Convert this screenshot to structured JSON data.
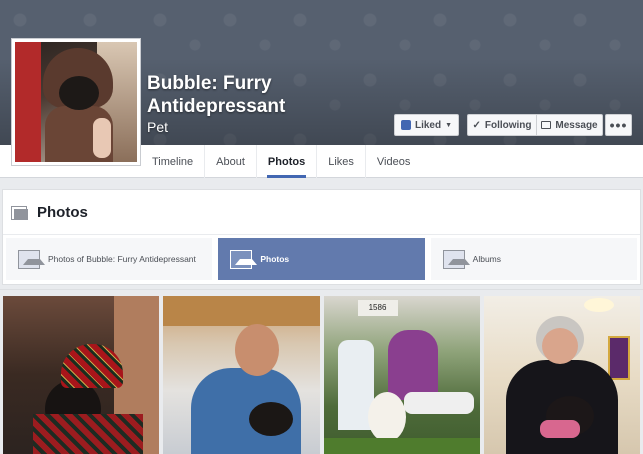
{
  "page": {
    "name": "Bubble: Furry Antidepressant",
    "category": "Pet"
  },
  "actions": {
    "liked_label": "Liked",
    "following_label": "Following",
    "message_label": "Message",
    "more_label": "•••"
  },
  "tabs": [
    {
      "label": "Timeline",
      "active": false
    },
    {
      "label": "About",
      "active": false
    },
    {
      "label": "Photos",
      "active": true
    },
    {
      "label": "Likes",
      "active": false
    },
    {
      "label": "Videos",
      "active": false
    }
  ],
  "photos_section": {
    "title": "Photos",
    "subtabs": [
      {
        "label": "Photos of Bubble: Furry Antidepressant",
        "active": false
      },
      {
        "label": "Photos",
        "active": true
      },
      {
        "label": "Albums",
        "active": false
      }
    ]
  },
  "photo_grid": {
    "sign_text": "1586"
  },
  "colors": {
    "accent": "#4267b2",
    "active_subtab": "#627aad",
    "cover": "#56606f"
  }
}
